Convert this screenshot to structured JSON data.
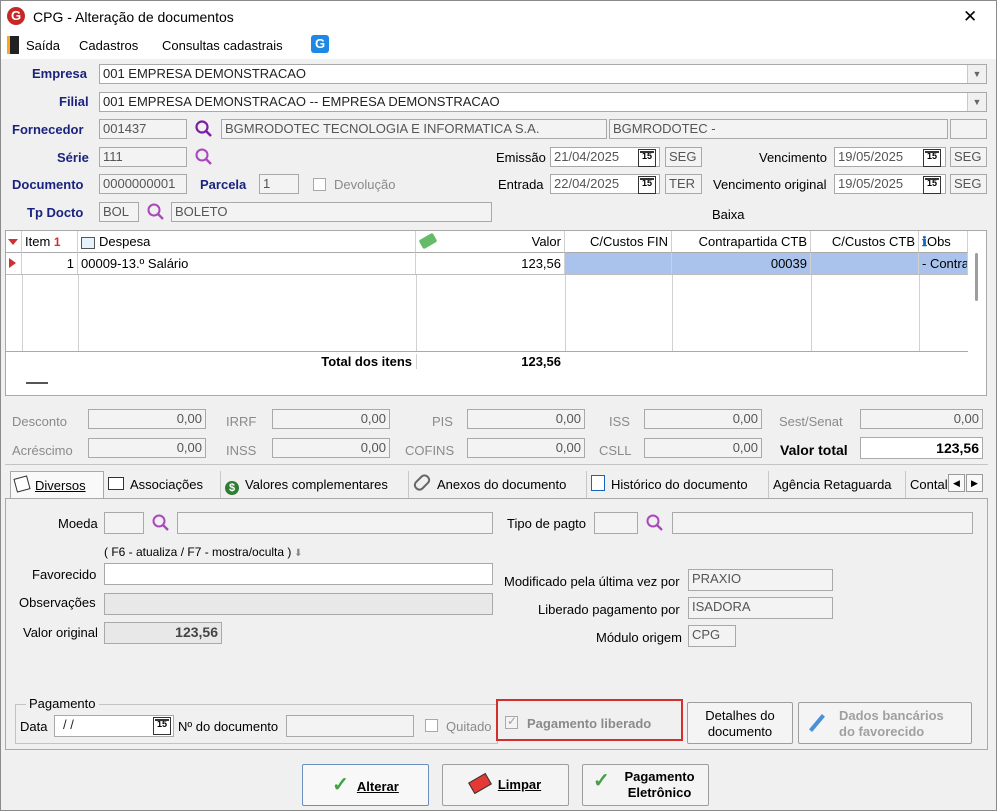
{
  "window": {
    "title": "CPG - Alteração de documentos",
    "close_glyph": "✕",
    "app_logo": "G"
  },
  "menu": {
    "items": [
      "Saída",
      "Cadastros",
      "Consultas cadastrais"
    ]
  },
  "header": {
    "empresa_label": "Empresa",
    "empresa_value": "001 EMPRESA DEMONSTRACAO",
    "filial_label": "Filial",
    "filial_value": "001 EMPRESA DEMONSTRACAO -- EMPRESA DEMONSTRACAO",
    "fornecedor_label": "Fornecedor",
    "fornecedor_code": "001437",
    "fornecedor_name": "BGMRODOTEC TECNOLOGIA E INFORMATICA S.A.",
    "fornecedor_short": "BGMRODOTEC -",
    "serie_label": "Série",
    "serie_value": "111",
    "documento_label": "Documento",
    "documento_value": "0000000001",
    "parcela_label": "Parcela",
    "parcela_value": "1",
    "devolucao_label": "Devolução",
    "tpdocto_label": "Tp Docto",
    "tpdocto_code": "BOL",
    "tpdocto_name": "BOLETO",
    "emissao_label": "Emissão",
    "emissao_value": "21/04/2025",
    "emissao_day": "SEG",
    "entrada_label": "Entrada",
    "entrada_value": "22/04/2025",
    "entrada_day": "TER",
    "vencimento_label": "Vencimento",
    "vencimento_value": "19/05/2025",
    "vencimento_day": "SEG",
    "venc_original_label": "Vencimento original",
    "venc_original_value": "19/05/2025",
    "venc_original_day": "SEG",
    "baixa_label": "Baixa",
    "cal_day": "15"
  },
  "grid": {
    "columns": {
      "item": "Item",
      "item_sort": "1",
      "despesa": "Despesa",
      "valor": "Valor",
      "ccfin": "C/Custos FIN",
      "contrapartida": "Contrapartida CTB",
      "ccctb": "C/Custos CTB",
      "obs": "Obs"
    },
    "rows": [
      {
        "item": "1",
        "despesa": "00009-13.º Salário",
        "valor": "123,56",
        "ccfin": "",
        "contrapartida": "00039",
        "ccctb": "",
        "obs": "- Contra"
      }
    ],
    "total_label": "Total dos itens",
    "total_value": "123,56"
  },
  "totals": {
    "desconto_label": "Desconto",
    "desconto": "0,00",
    "irrf_label": "IRRF",
    "irrf": "0,00",
    "pis_label": "PIS",
    "pis": "0,00",
    "iss_label": "ISS",
    "iss": "0,00",
    "sest_label": "Sest/Senat",
    "sest": "0,00",
    "acrescimo_label": "Acréscimo",
    "acrescimo": "0,00",
    "inss_label": "INSS",
    "inss": "0,00",
    "cofins_label": "COFINS",
    "cofins": "0,00",
    "csll_label": "CSLL",
    "csll": "0,00",
    "valor_total_label": "Valor total",
    "valor_total": "123,56"
  },
  "tabs": [
    "Diversos",
    "Associações",
    "Valores complementares",
    "Anexos do documento",
    "Histórico do documento",
    "Agência Retaguarda",
    "Contal"
  ],
  "diversos": {
    "moeda_label": "Moeda",
    "tipo_pagto_label": "Tipo de pagto",
    "hint": "( F6 - atualiza / F7 - mostra/oculta )",
    "favorecido_label": "Favorecido",
    "favorecido_value": "",
    "observacoes_label": "Observações",
    "valor_original_label": "Valor original",
    "valor_original": "123,56",
    "modificado_label": "Modificado pela última vez por",
    "modificado_value": "PRAXIO",
    "liberado_label": "Liberado pagamento por",
    "liberado_value": "ISADORA",
    "modulo_label": "Módulo origem",
    "modulo_value": "CPG",
    "pagamento_group": "Pagamento",
    "data_label": "Data",
    "data_value": "/ /",
    "ndoc_label": "Nº do documento",
    "quitado_label": "Quitado",
    "pag_liberado_label": "Pagamento liberado",
    "detalhes_label_1": "Detalhes do",
    "detalhes_label_2": "documento",
    "dados_label_1": "Dados bancários",
    "dados_label_2": "do favorecido"
  },
  "footer": {
    "alterar": "Alterar",
    "limpar": "Limpar",
    "pag_eletronico_1": "Pagamento",
    "pag_eletronico_2": "Eletrônico"
  },
  "colors": {
    "label_blue": "#1a237e",
    "selected_row": "#a9c3ec",
    "highlight_red": "#d32f2f",
    "magnifier": "#7b1fa2"
  }
}
